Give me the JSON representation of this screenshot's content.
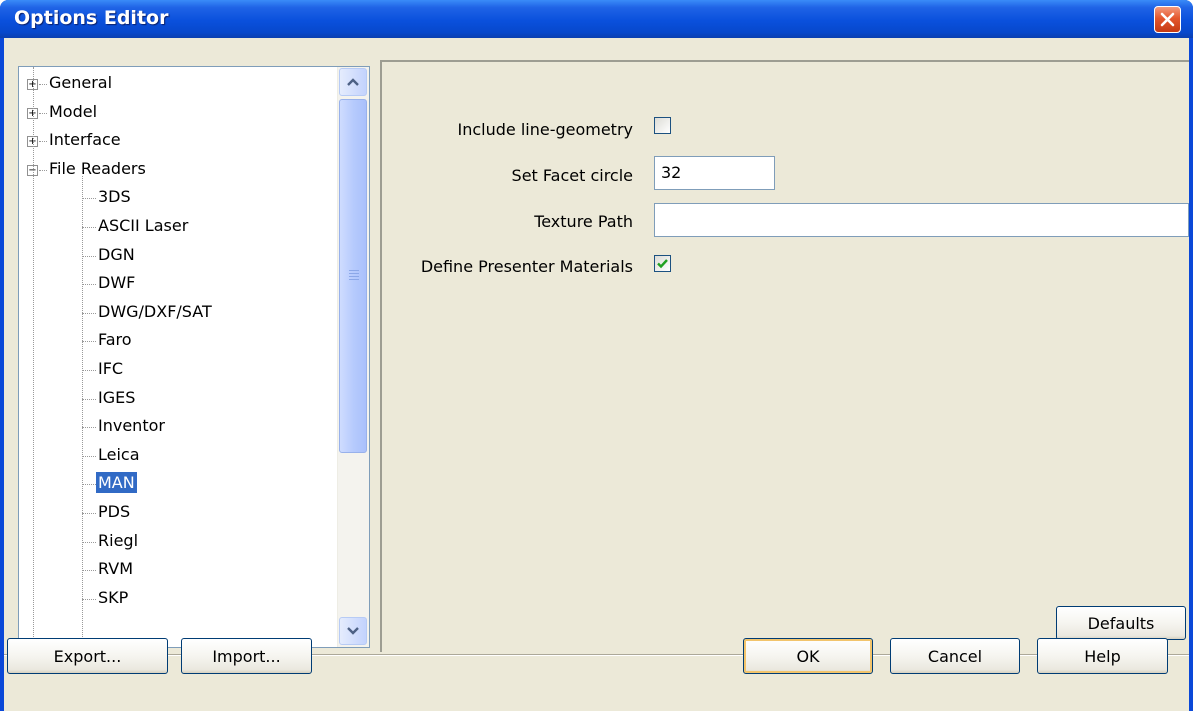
{
  "window": {
    "title": "Options Editor"
  },
  "tree": {
    "items": [
      {
        "label": "General",
        "expander": "+"
      },
      {
        "label": "Model",
        "expander": "+"
      },
      {
        "label": "Interface",
        "expander": "+"
      },
      {
        "label": "File Readers",
        "expander": "−"
      },
      {
        "label": "3DS"
      },
      {
        "label": "ASCII Laser"
      },
      {
        "label": "DGN"
      },
      {
        "label": "DWF"
      },
      {
        "label": "DWG/DXF/SAT"
      },
      {
        "label": "Faro"
      },
      {
        "label": "IFC"
      },
      {
        "label": "IGES"
      },
      {
        "label": "Inventor"
      },
      {
        "label": "Leica"
      },
      {
        "label": "MAN",
        "selected": true
      },
      {
        "label": "PDS"
      },
      {
        "label": "Riegl"
      },
      {
        "label": "RVM"
      },
      {
        "label": "SKP"
      }
    ]
  },
  "options": {
    "include_line_geometry_label": "Include line-geometry",
    "include_line_geometry_checked": false,
    "facet_circle_label": "Set Facet circle",
    "facet_circle_value": "32",
    "texture_path_label": "Texture Path",
    "texture_path_value": "",
    "presenter_materials_label": "Define Presenter Materials",
    "presenter_materials_checked": true
  },
  "buttons": {
    "defaults": "Defaults",
    "export": "Export...",
    "import": "Import...",
    "ok": "OK",
    "cancel": "Cancel",
    "help": "Help"
  },
  "colors": {
    "titlebar": "#0a50dc",
    "selection": "#316ac5",
    "dialog_face": "#ece9d8",
    "close_button": "#e4572d",
    "checkmark": "#21a121"
  }
}
